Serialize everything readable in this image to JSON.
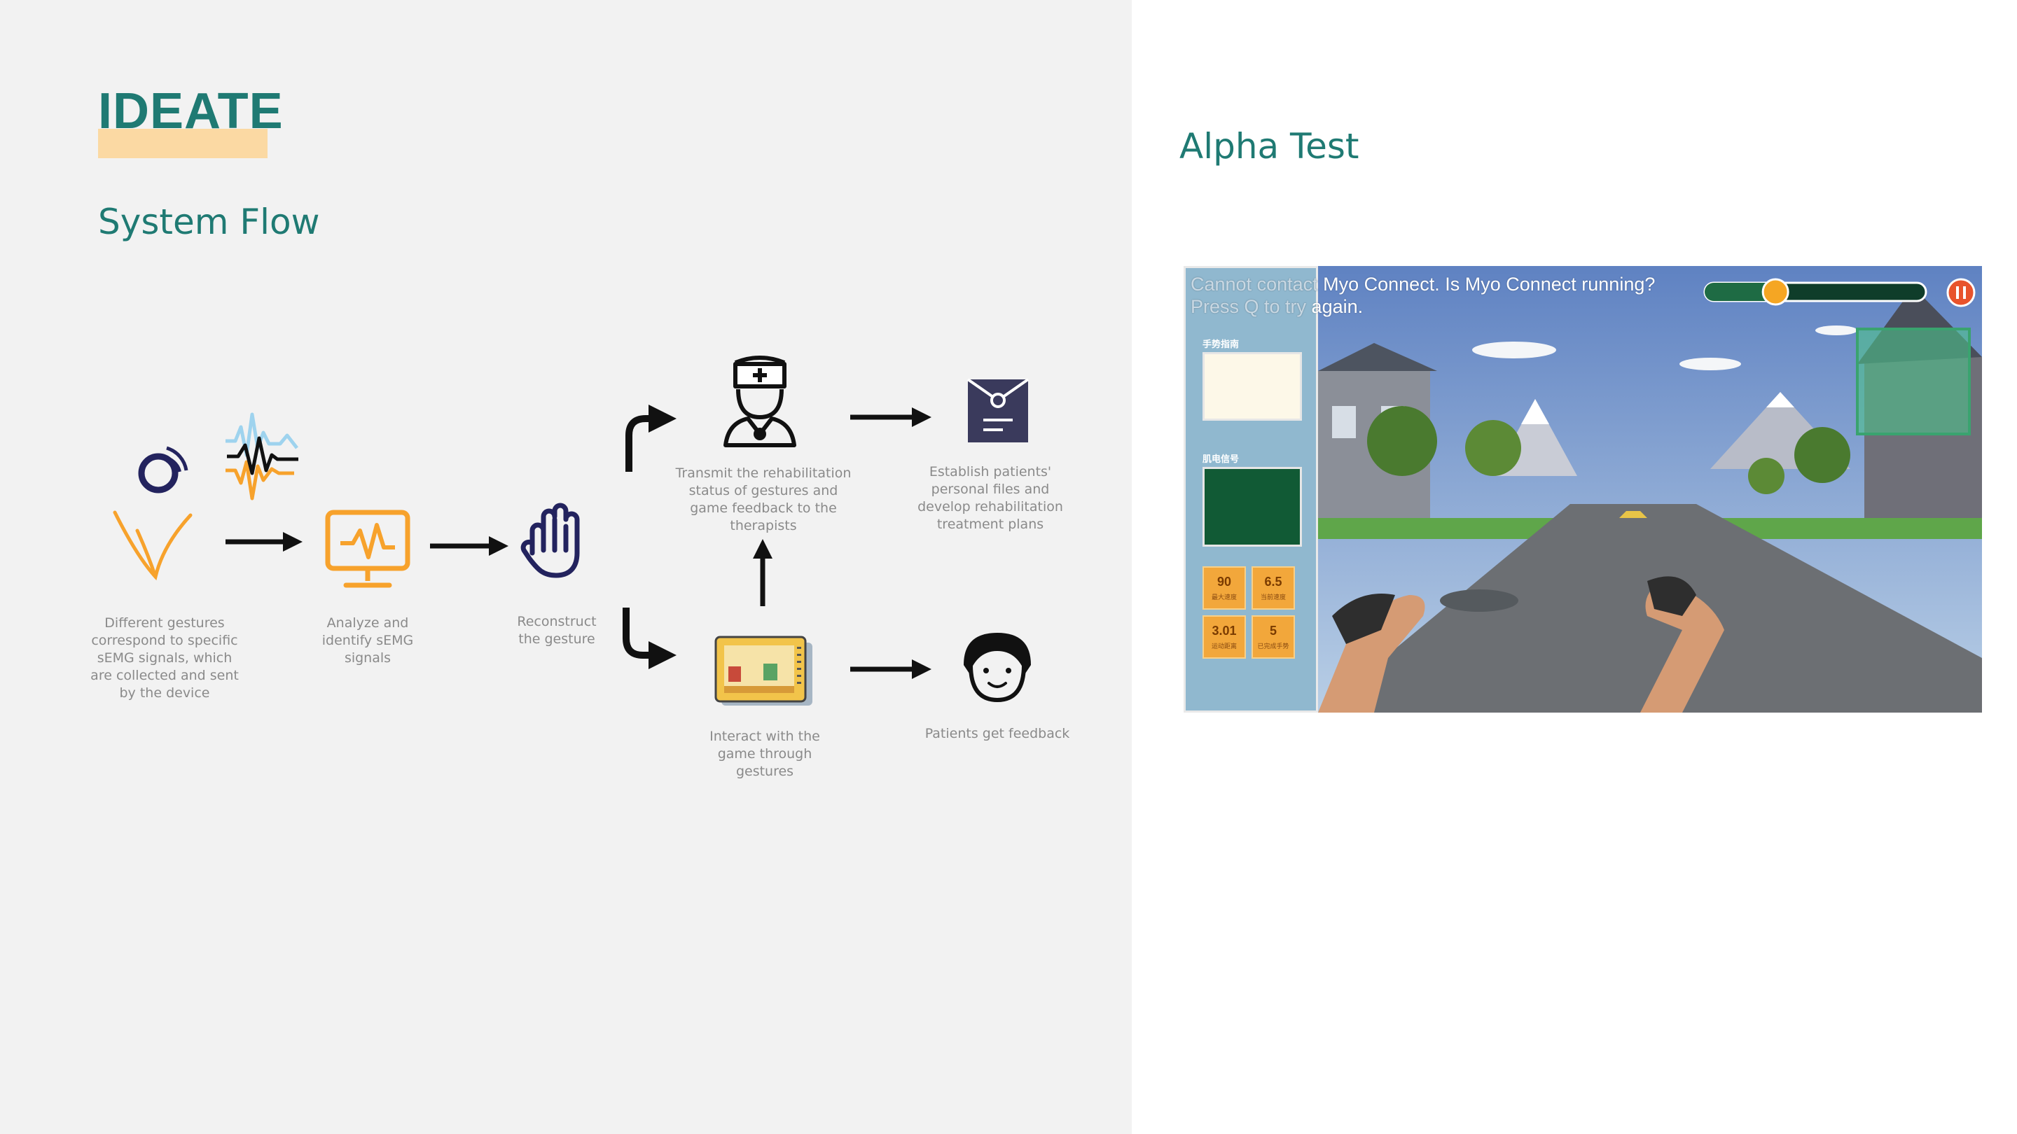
{
  "heading": "IDEATE",
  "left_section_title": "System Flow",
  "right_section_title": "Alpha Test",
  "flow": {
    "captions": {
      "gestures": "Different gestures correspond to specific sEMG signals, which are collected and sent by the device",
      "analyze": "Analyze and identify sEMG signals",
      "reconstruct": "Reconstruct the gesture",
      "transmit": "Transmit the rehabilitation status of gestures and game feedback to the therapists",
      "establish": "Establish patients' personal files and develop rehabilitation treatment plans",
      "interact": "Interact with the game through gestures",
      "feedback": "Patients get feedback"
    },
    "icons": [
      "armband-icon",
      "wave-signal-icon",
      "gesture-v-icon",
      "monitor-pulse-icon",
      "hand-icon",
      "doctor-icon",
      "file-folder-icon",
      "game-cartridge-icon",
      "patient-face-icon"
    ]
  },
  "game": {
    "message_line1_a": "Cannot contact",
    "message_line1_b": " Myo Connect. Is Myo Connect running?",
    "message_line2_a": "Press Q to try",
    "message_line2_b": " again.",
    "guide_label": "手势指南",
    "emg_label": "肌电信号",
    "stats": [
      {
        "value": "90",
        "label": "最大速度"
      },
      {
        "value": "6.5",
        "label": "当前速度"
      },
      {
        "value": "3.01",
        "label": "运动距离"
      },
      {
        "value": "5",
        "label": "已完成手势"
      }
    ],
    "progress": 0.32,
    "colors": {
      "panel": "#90b8cf",
      "emg": "#115a35",
      "stat": "#f2a73b",
      "accent": "#1f7a73"
    }
  }
}
